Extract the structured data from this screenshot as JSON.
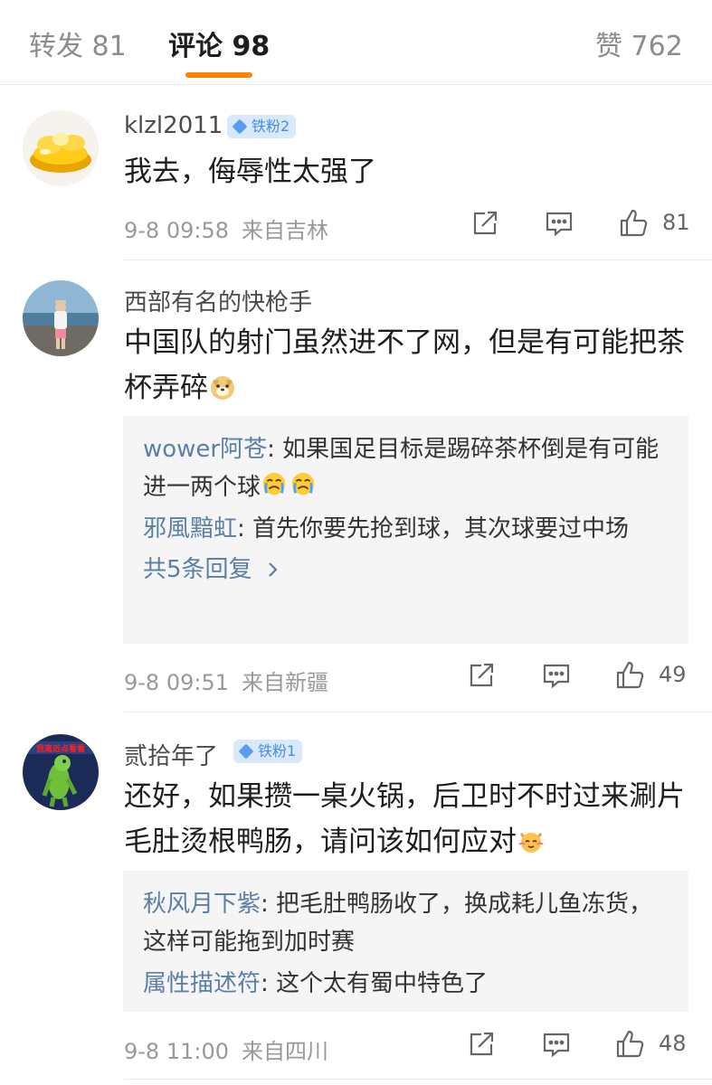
{
  "tabs": [
    {
      "label": "转发 81"
    },
    {
      "label": "评论 98"
    },
    {
      "label": "赞 762"
    }
  ],
  "accent_color": "#ff8200",
  "comments": [
    {
      "username": "klzl2011",
      "badge": "铁粉2",
      "content": "我去，侮辱性太强了",
      "time": "9-8 09:58",
      "location": "来自吉林",
      "likes": "81",
      "avatar_icon": "gold-ingot-avatar"
    },
    {
      "username": "西部有名的快枪手",
      "content": "中国队的射门虽然进不了网，但是有可能把茶杯弄碎",
      "emoji_icon": "doge-emoji-icon",
      "replies": [
        {
          "name": "wower阿苍",
          "text": ": 如果国足目标是踢碎茶杯倒是有可能进一两个球"
        },
        {
          "name": "邪風黯虹",
          "text": ": 首先你要先抢到球，其次球要过中场"
        }
      ],
      "more_replies": "共5条回复",
      "time": "9-8 09:51",
      "location": "来自新疆",
      "likes": "49",
      "avatar_icon": "beach-person-avatar"
    },
    {
      "username": "贰拾年了",
      "badge": "铁粉1",
      "content": "还好，如果攒一桌火锅，后卫时不时过来涮片毛肚烫根鸭肠，请问该如何应对",
      "emoji_icon": "cat-emoji-icon",
      "replies": [
        {
          "name": "秋风月下紫",
          "text": ": 把毛肚鸭肠收了，换成耗儿鱼冻货，这样可能拖到加时赛"
        },
        {
          "name": "属性描述符",
          "text": ": 这个太有蜀中特色了"
        }
      ],
      "time": "9-8 11:00",
      "location": "来自四川",
      "likes": "48",
      "avatar_icon": "dinosaur-avatar",
      "avatar_text": "我离远点看看"
    }
  ]
}
